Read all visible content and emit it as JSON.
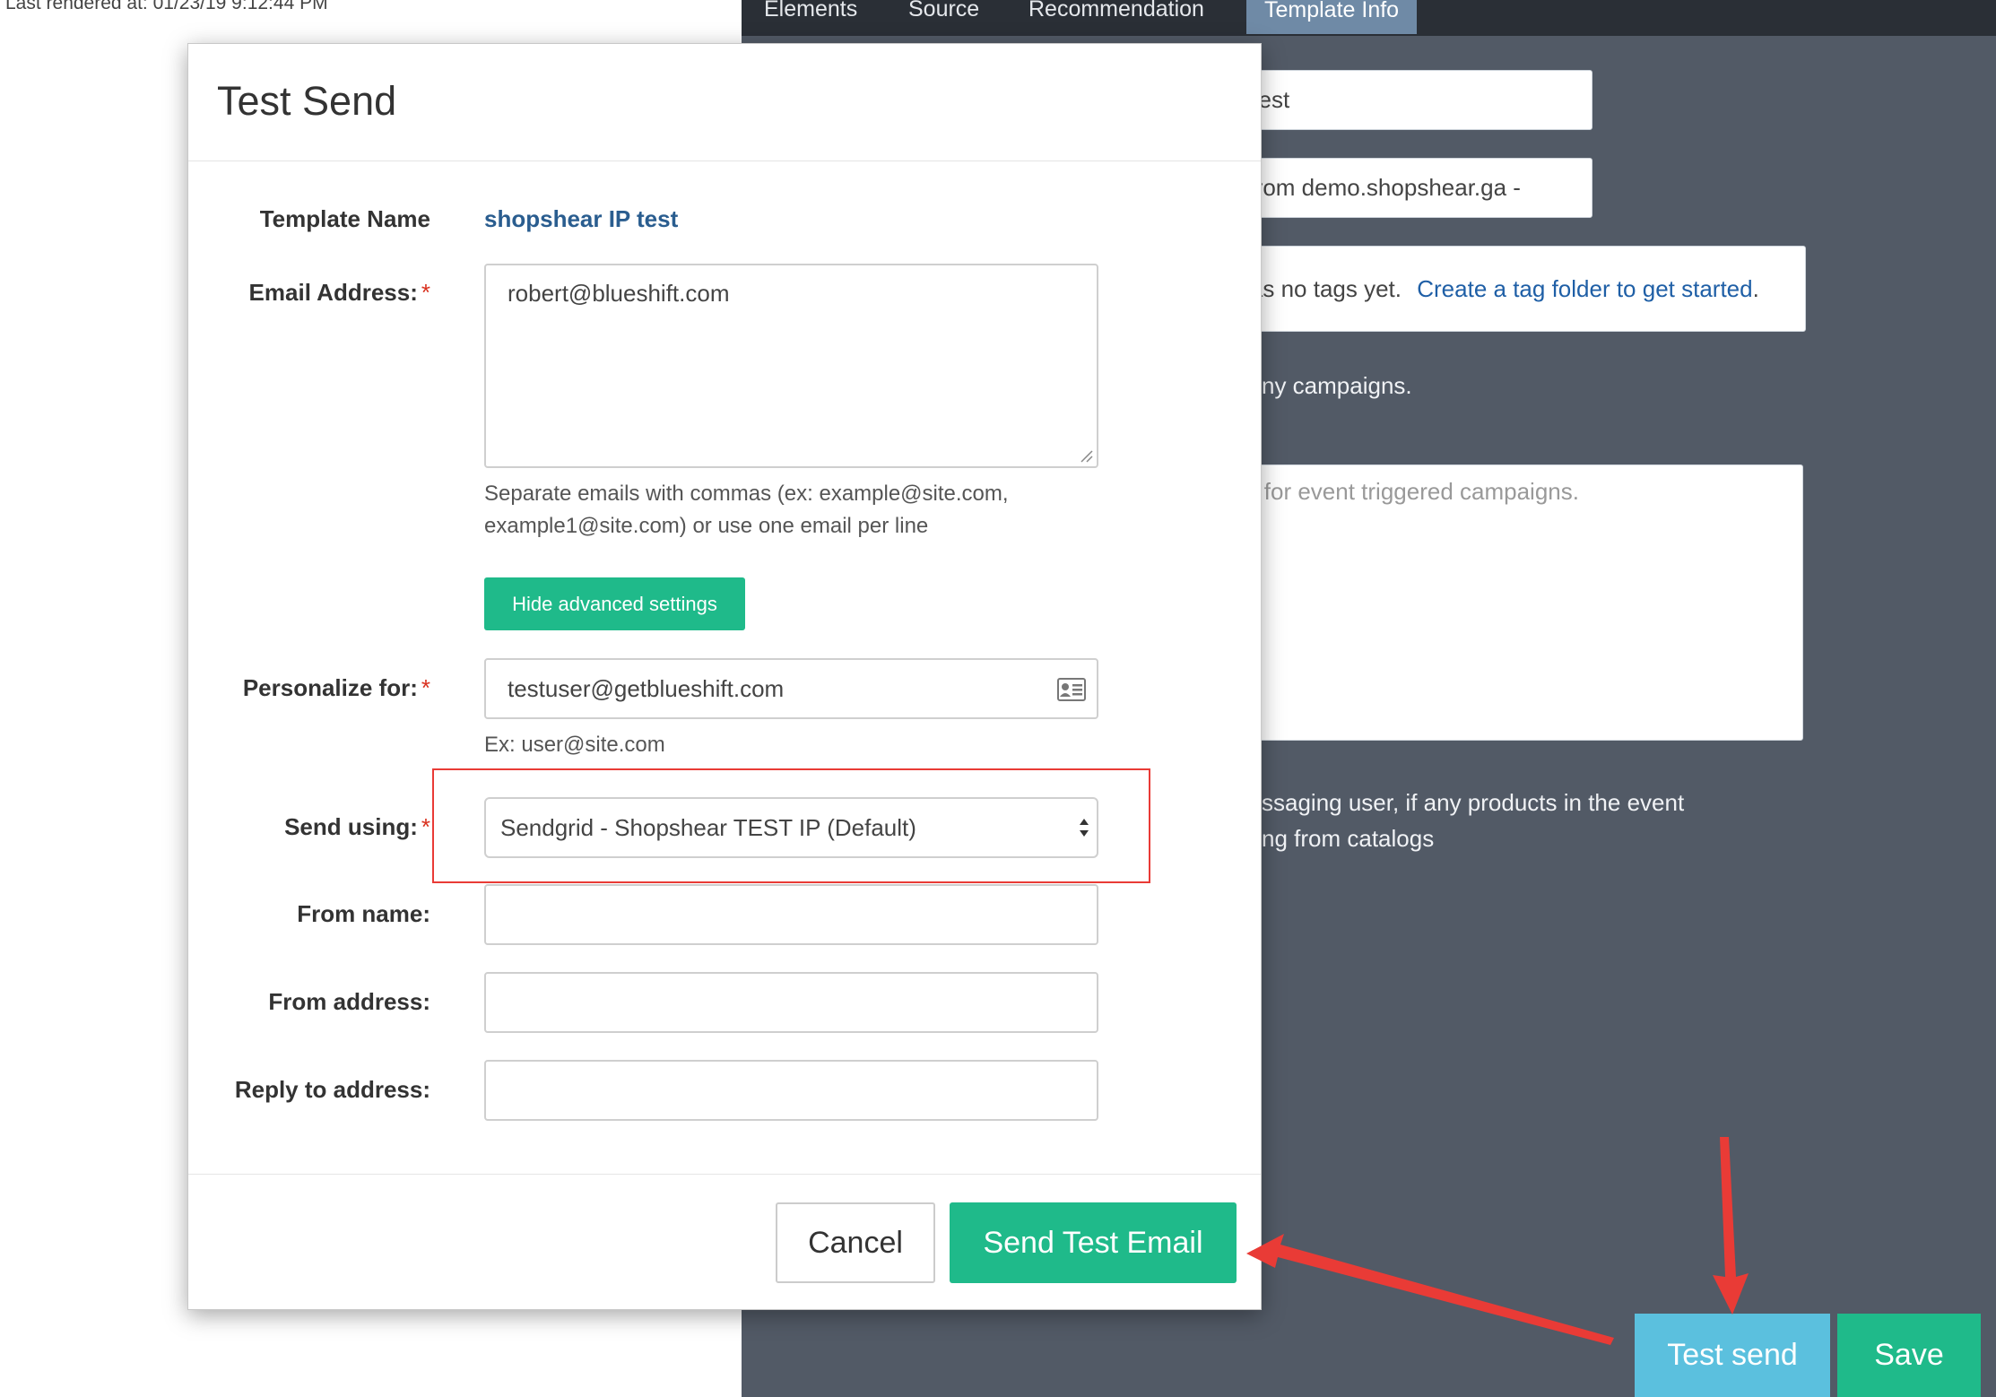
{
  "last_rendered": "Last rendered at: 01/23/19 9:12:44 PM",
  "nav": {
    "tabs": [
      "Elements",
      "Source",
      "Recommendation",
      "Template Info"
    ],
    "active_tab": "Template Info"
  },
  "background": {
    "name_field_value": "IP test",
    "subject_field_value": "st from demo.shopshear.ga -",
    "tags_text": "t has no tags yet.",
    "tags_link": "Create a tag folder to get started",
    "tags_period": ".",
    "campaigns_text": "ny campaigns.",
    "textarea_placeholder": "DN for event triggered campaigns.",
    "note_line1": "ssaging user, if any products in the event",
    "note_line2": "ng from catalogs",
    "test_send_label": "Test send",
    "save_label": "Save"
  },
  "modal": {
    "title": "Test Send",
    "template_name_label": "Template Name",
    "template_name_value": "shopshear IP test",
    "email_label": "Email Address:",
    "email_value": "robert@blueshift.com",
    "email_help_line1": "Separate emails with commas (ex: example@site.com,",
    "email_help_line2": "example1@site.com) or use one email per line",
    "hide_advanced_label": "Hide advanced settings",
    "personalize_label": "Personalize for:",
    "personalize_value": "testuser@getblueshift.com",
    "personalize_help": "Ex: user@site.com",
    "send_using_label": "Send using:",
    "send_using_value": "Sendgrid - Shopshear TEST IP (Default)",
    "from_name_label": "From name:",
    "from_address_label": "From address:",
    "reply_to_label": "Reply to address:",
    "required_mark": "*",
    "cancel_label": "Cancel",
    "send_label": "Send Test Email"
  },
  "colors": {
    "accent_green": "#1fba8a",
    "test_send_blue": "#5bc0de",
    "annotation_red": "#e93b36",
    "panel_dark": "#525a66"
  },
  "icons": {
    "contact_card": "contact-card-icon",
    "select_arrows": "select-arrows-icon",
    "resize_handle": "resize-handle-icon"
  }
}
